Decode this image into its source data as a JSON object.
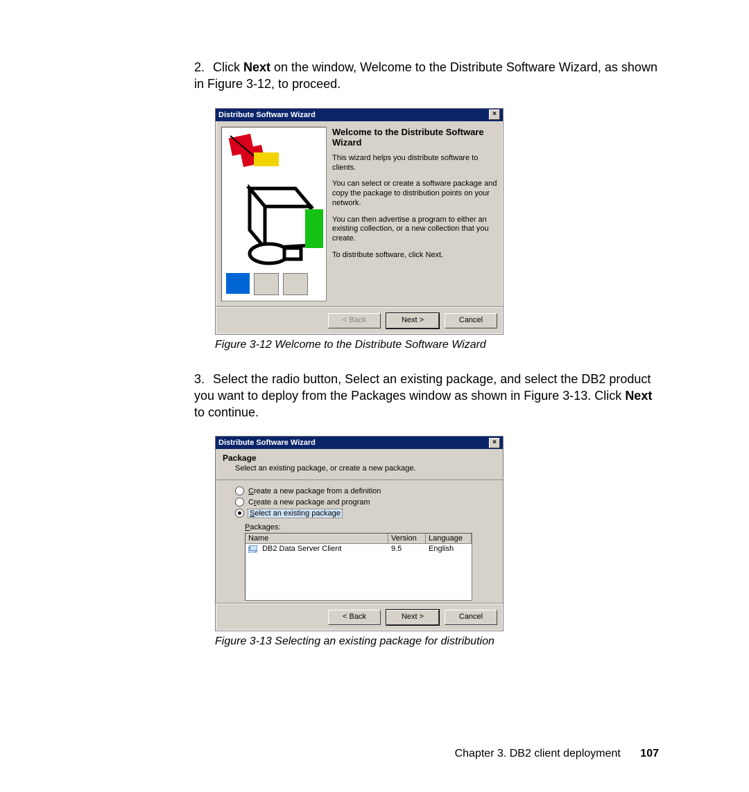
{
  "step2_pre": "Click ",
  "step2_bold": "Next",
  "step2_post": " on the window, Welcome to the Distribute Software Wizard, as shown in Figure 3-12, to proceed.",
  "fig12_caption": "Figure 3-12   Welcome to the Distribute Software Wizard",
  "step3_pre": "Select the radio button, Select an existing package, and select the DB2 product you want to deploy from the Packages window as shown in Figure 3-13. Click ",
  "step3_bold": "Next",
  "step3_post": " to continue.",
  "fig13_caption": "Figure 3-13   Selecting an existing package for distribution",
  "footer_chapter": "Chapter 3. DB2 client deployment",
  "footer_page": "107",
  "wiz1": {
    "title": "Distribute Software Wizard",
    "heading": "Welcome to the Distribute Software Wizard",
    "p1": "This wizard helps you distribute software to clients.",
    "p2": "You can select or create a software package and copy the package to distribution points on your network.",
    "p3": "You can then advertise a program to either an existing collection, or a new collection that you create.",
    "p4": "To distribute software, click Next.",
    "back": "< Back",
    "next": "Next >",
    "cancel": "Cancel"
  },
  "wiz2": {
    "title": "Distribute Software Wizard",
    "head_t": "Package",
    "head_s": "Select an existing package, or create a new package.",
    "opt1": "Create a new package from a definition",
    "opt2": "Create a new package and program",
    "opt3": "Select an existing package",
    "packages_label": "Packages:",
    "col_name": "Name",
    "col_ver": "Version",
    "col_lang": "Language",
    "row_name": "DB2 Data Server Client",
    "row_ver": "9.5",
    "row_lang": "English",
    "back": "< Back",
    "next": "Next >",
    "cancel": "Cancel"
  }
}
